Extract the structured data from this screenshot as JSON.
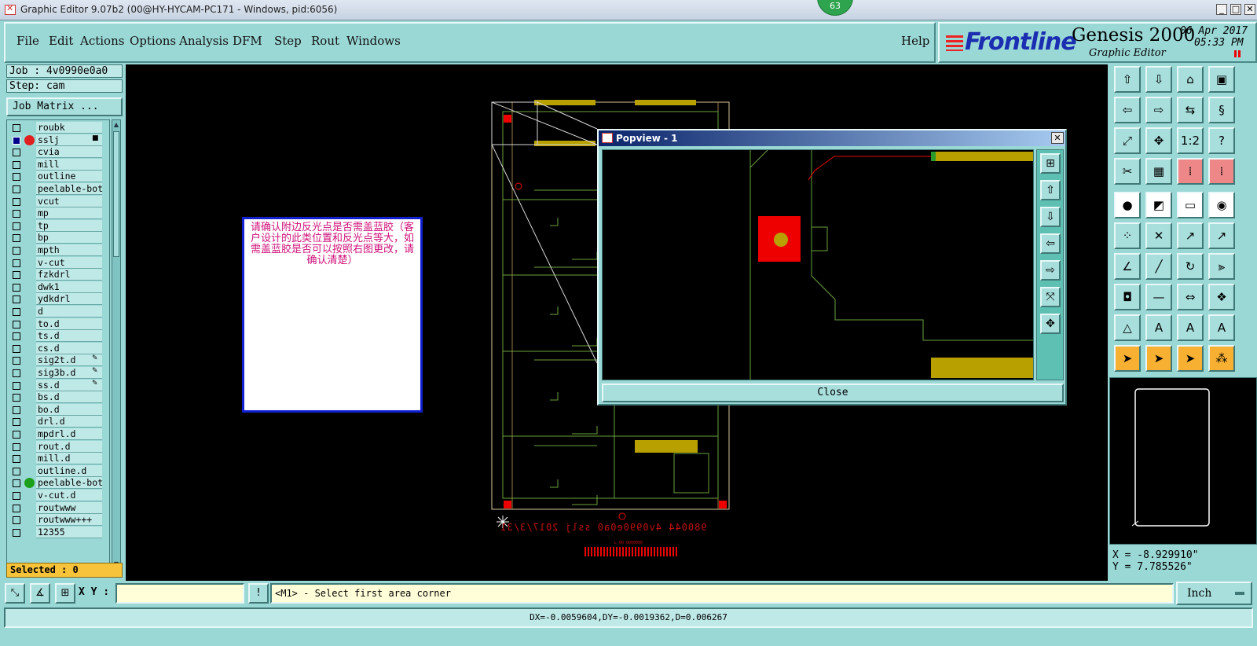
{
  "window": {
    "title": "Graphic Editor 9.07b2 (00@HY-HYCAM-PC171 - Windows, pid:6056)",
    "badge": "63"
  },
  "menu": [
    "File",
    "Edit",
    "Actions",
    "Options",
    "Analysis",
    "DFM",
    "Step",
    "Rout",
    "Windows"
  ],
  "help_label": "Help",
  "banner": {
    "logo": "Frontline",
    "product": "Genesis 2000",
    "subtitle": "Graphic Editor",
    "date": "06 Apr 2017",
    "time": "05:33 PM"
  },
  "job": "Job : 4v0990e0a0",
  "step": "Step: cam",
  "job_matrix_label": "Job Matrix ...",
  "layers": [
    {
      "name": "roubk"
    },
    {
      "name": "sslj",
      "selected": true,
      "dot": "#e02020",
      "mark": "■"
    },
    {
      "name": "cvia"
    },
    {
      "name": "mill"
    },
    {
      "name": "outline"
    },
    {
      "name": "peelable-bot"
    },
    {
      "name": "vcut"
    },
    {
      "name": "mp"
    },
    {
      "name": "tp"
    },
    {
      "name": "bp"
    },
    {
      "name": "mpth"
    },
    {
      "name": "v-cut"
    },
    {
      "name": "fzkdrl"
    },
    {
      "name": "dwk1"
    },
    {
      "name": "ydkdrl"
    },
    {
      "name": "d"
    },
    {
      "name": "to.d"
    },
    {
      "name": "ts.d"
    },
    {
      "name": "cs.d"
    },
    {
      "name": "sig2t.d",
      "mark": "✎"
    },
    {
      "name": "sig3b.d",
      "mark": "✎"
    },
    {
      "name": "ss.d",
      "mark": "✎"
    },
    {
      "name": "bs.d"
    },
    {
      "name": "bo.d"
    },
    {
      "name": "drl.d"
    },
    {
      "name": "mpdrl.d"
    },
    {
      "name": "rout.d"
    },
    {
      "name": "mill.d"
    },
    {
      "name": "outline.d"
    },
    {
      "name": "peelable-bot",
      "dot": "#1aa01a"
    },
    {
      "name": "v-cut.d"
    },
    {
      "name": "routwww"
    },
    {
      "name": "routwww+++"
    },
    {
      "name": "12355"
    }
  ],
  "selected_label": "Selected : 0",
  "note_text": "请确认附边反光点是否需盖蓝胶（客户设计的此类位置和反光点等大，如需盖蓝胶是否可以按照右图更改，请确认清楚）",
  "board_text": "980044 4v0990e0a0 sslj 2017/3/31",
  "popview": {
    "title": "Popview - 1",
    "close_label": "Close"
  },
  "coords": {
    "x": "X = -8.929910\"",
    "y": "Y = 7.785526\""
  },
  "cmd": {
    "xy_label": "X Y :",
    "xy_value": "",
    "prompt": "<M1> - Select first area corner"
  },
  "unit_label": "Inch",
  "status": "DX=-0.0059604,DY=-0.0019362,D=0.006267",
  "icons": {
    "zoom_home": "home-icon",
    "zoom_fit": "fit-icon"
  }
}
